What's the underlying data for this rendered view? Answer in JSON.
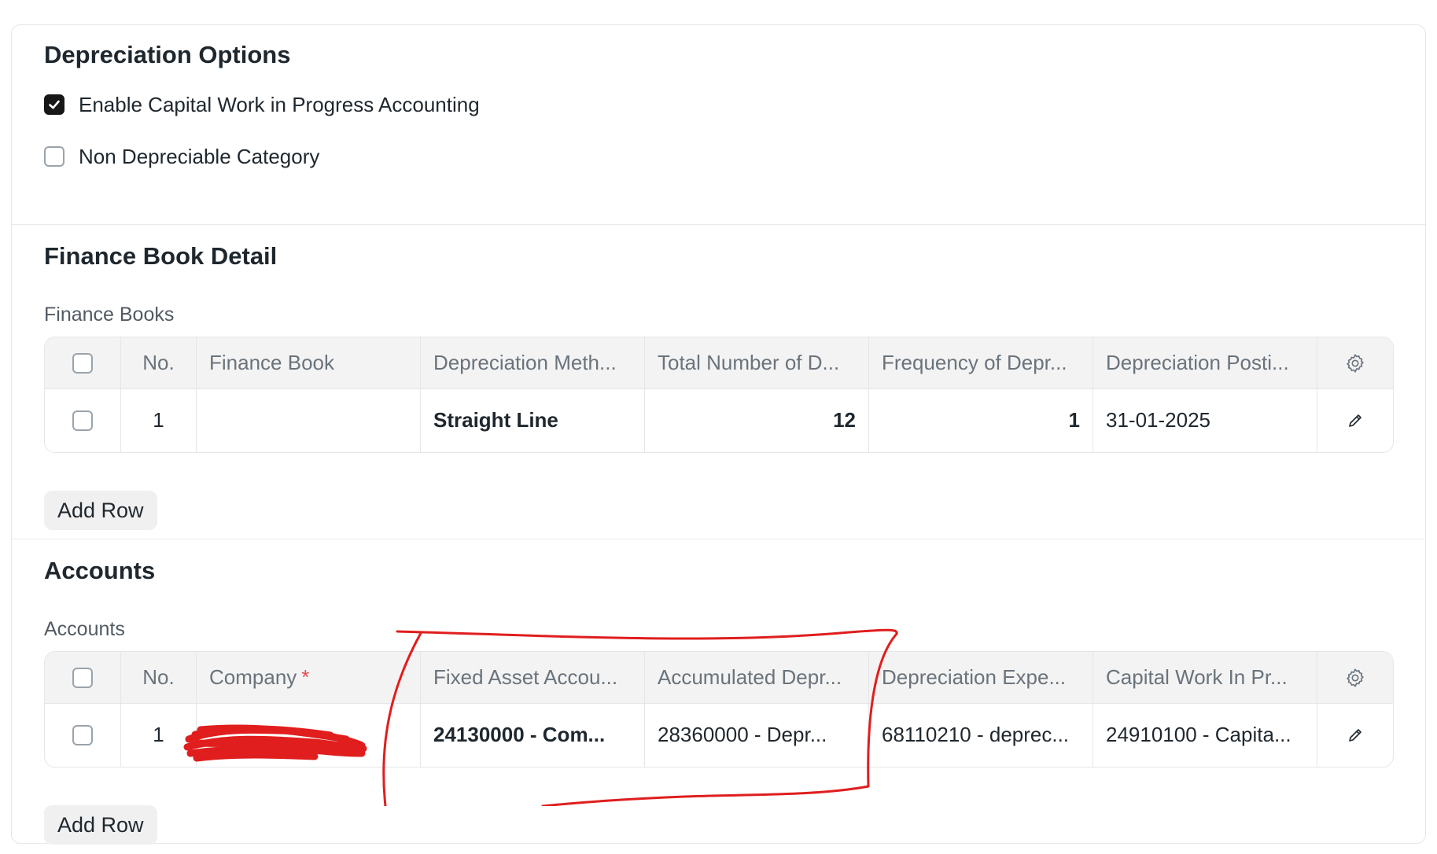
{
  "depreciation_options": {
    "title": "Depreciation Options",
    "enable_cwip": {
      "label": "Enable Capital Work in Progress Accounting",
      "checked": true
    },
    "non_depreciable": {
      "label": "Non Depreciable Category",
      "checked": false
    }
  },
  "finance_book_detail": {
    "title": "Finance Book Detail",
    "table_label": "Finance Books",
    "headers": {
      "no": "No.",
      "finance_book": "Finance Book",
      "depreciation_method": "Depreciation Meth...",
      "total_number": "Total Number of D...",
      "frequency": "Frequency of Depr...",
      "posting_date": "Depreciation Posti..."
    },
    "rows": [
      {
        "no": "1",
        "finance_book": "",
        "depreciation_method": "Straight Line",
        "total_number": "12",
        "frequency": "1",
        "posting_date": "31-01-2025"
      }
    ],
    "add_row_label": "Add Row"
  },
  "accounts": {
    "title": "Accounts",
    "table_label": "Accounts",
    "headers": {
      "no": "No.",
      "company": "Company",
      "required_mark": "*",
      "fixed_asset_account": "Fixed Asset Accou...",
      "accumulated_depreciation": "Accumulated Depr...",
      "depreciation_expense": "Depreciation Expe...",
      "cwip": "Capital Work In Pr..."
    },
    "rows": [
      {
        "no": "1",
        "company": "",
        "fixed_asset_account": "24130000 - Com...",
        "accumulated_depreciation": "28360000 - Depr...",
        "depreciation_expense": "68110210 - deprec...",
        "cwip": "24910100 - Capita..."
      }
    ],
    "add_row_label": "Add Row"
  },
  "icons": {
    "settings": "gear-icon",
    "edit": "pencil-icon",
    "check": "checkmark-icon"
  },
  "colors": {
    "annotation_red": "#e01e1e",
    "checkbox_checked": "#171717",
    "header_bg": "#f3f3f3"
  }
}
